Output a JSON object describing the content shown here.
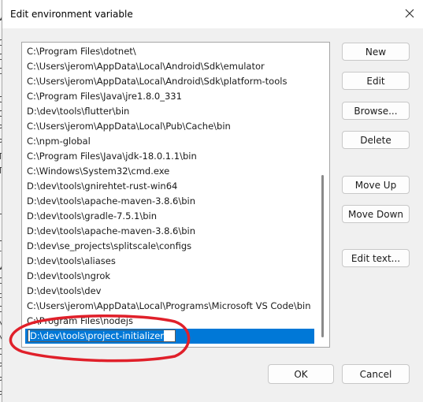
{
  "dialog": {
    "title": "Edit environment variable",
    "close_icon": "close-icon"
  },
  "paths": [
    "C:\\Program Files\\dotnet\\",
    "C:\\Users\\jerom\\AppData\\Local\\Android\\Sdk\\emulator",
    "C:\\Users\\jerom\\AppData\\Local\\Android\\Sdk\\platform-tools",
    "C:\\Program Files\\Java\\jre1.8.0_331",
    "D:\\dev\\tools\\flutter\\bin",
    "C:\\Users\\jerom\\AppData\\Local\\Pub\\Cache\\bin",
    "C:\\npm-global",
    "C:\\Program Files\\Java\\jdk-18.0.1.1\\bin",
    "C:\\Windows\\System32\\cmd.exe",
    "D:\\dev\\tools\\gnirehtet-rust-win64",
    "D:\\dev\\tools\\apache-maven-3.8.6\\bin",
    "D:\\dev\\tools\\gradle-7.5.1\\bin",
    "D:\\dev\\tools\\apache-maven-3.8.6\\bin",
    "D:\\dev\\se_projects\\splitscale\\configs",
    "D:\\dev\\tools\\aliases",
    "D:\\dev\\tools\\ngrok",
    "D:\\dev\\tools\\dev",
    "C:\\Users\\jerom\\AppData\\Local\\Programs\\Microsoft VS Code\\bin",
    "C:\\Program Files\\nodejs"
  ],
  "editing_value": "D:\\dev\\tools\\project-initializer",
  "buttons": {
    "new": "New",
    "edit": "Edit",
    "browse": "Browse...",
    "delete": "Delete",
    "move_up": "Move Up",
    "move_down": "Move Down",
    "edit_text": "Edit text...",
    "ok": "OK",
    "cancel": "Cancel"
  },
  "background_fragments": [
    "Va",
    "Ch",
    "Ch",
    "Ch",
    "Or",
    "Or",
    "Pa",
    "PS",
    "Ta",
    "Ta",
    "U",
    "U",
    "rs",
    "Va",
    "Cl",
    "cl",
    "Dr",
    "N",
    "N",
    "OS",
    "Pa",
    "PA",
    "Pr",
    "PF"
  ],
  "colors": {
    "selection": "#0078d7",
    "annotation": "#e0202a",
    "dialog_bg": "#f0f0f0"
  }
}
